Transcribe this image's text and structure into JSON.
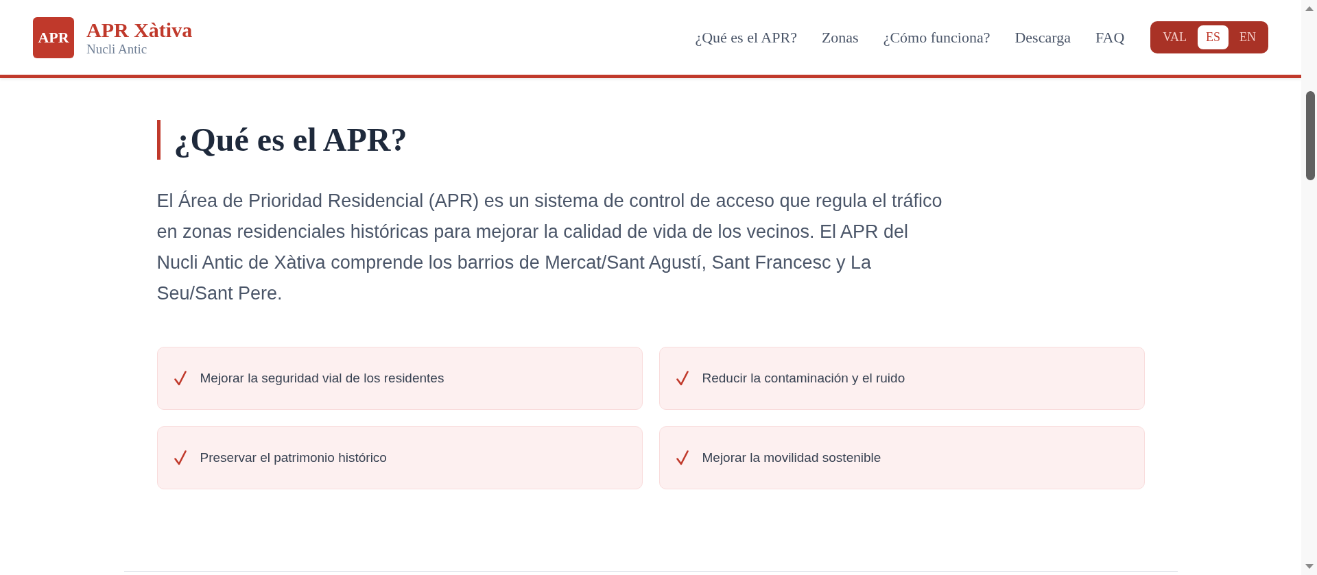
{
  "header": {
    "logo": "APR",
    "title": "APR Xàtiva",
    "subtitle": "Nucli Antic"
  },
  "nav": [
    "¿Qué es el APR?",
    "Zonas",
    "¿Cómo funciona?",
    "Descarga",
    "FAQ"
  ],
  "languages": [
    {
      "label": "VAL",
      "selected": false
    },
    {
      "label": "ES",
      "selected": true
    },
    {
      "label": "EN",
      "selected": false
    }
  ],
  "section": {
    "title": "¿Qué es el APR?",
    "text": "El Área de Prioridad Residencial (APR) es un sistema de control de acceso que regula el tráfico en zonas residenciales históricas para mejorar la calidad de vida de los vecinos. El APR del Nucli Antic de Xàtiva comprende los barrios de Mercat/Sant Agustí, Sant Francesc y La Seu/Sant Pere.",
    "benefits": [
      "Mejorar la seguridad vial de los residentes",
      "Reducir la contaminación y el ruido",
      "Preservar el patrimonio histórico",
      "Mejorar la movilidad sostenible"
    ]
  }
}
